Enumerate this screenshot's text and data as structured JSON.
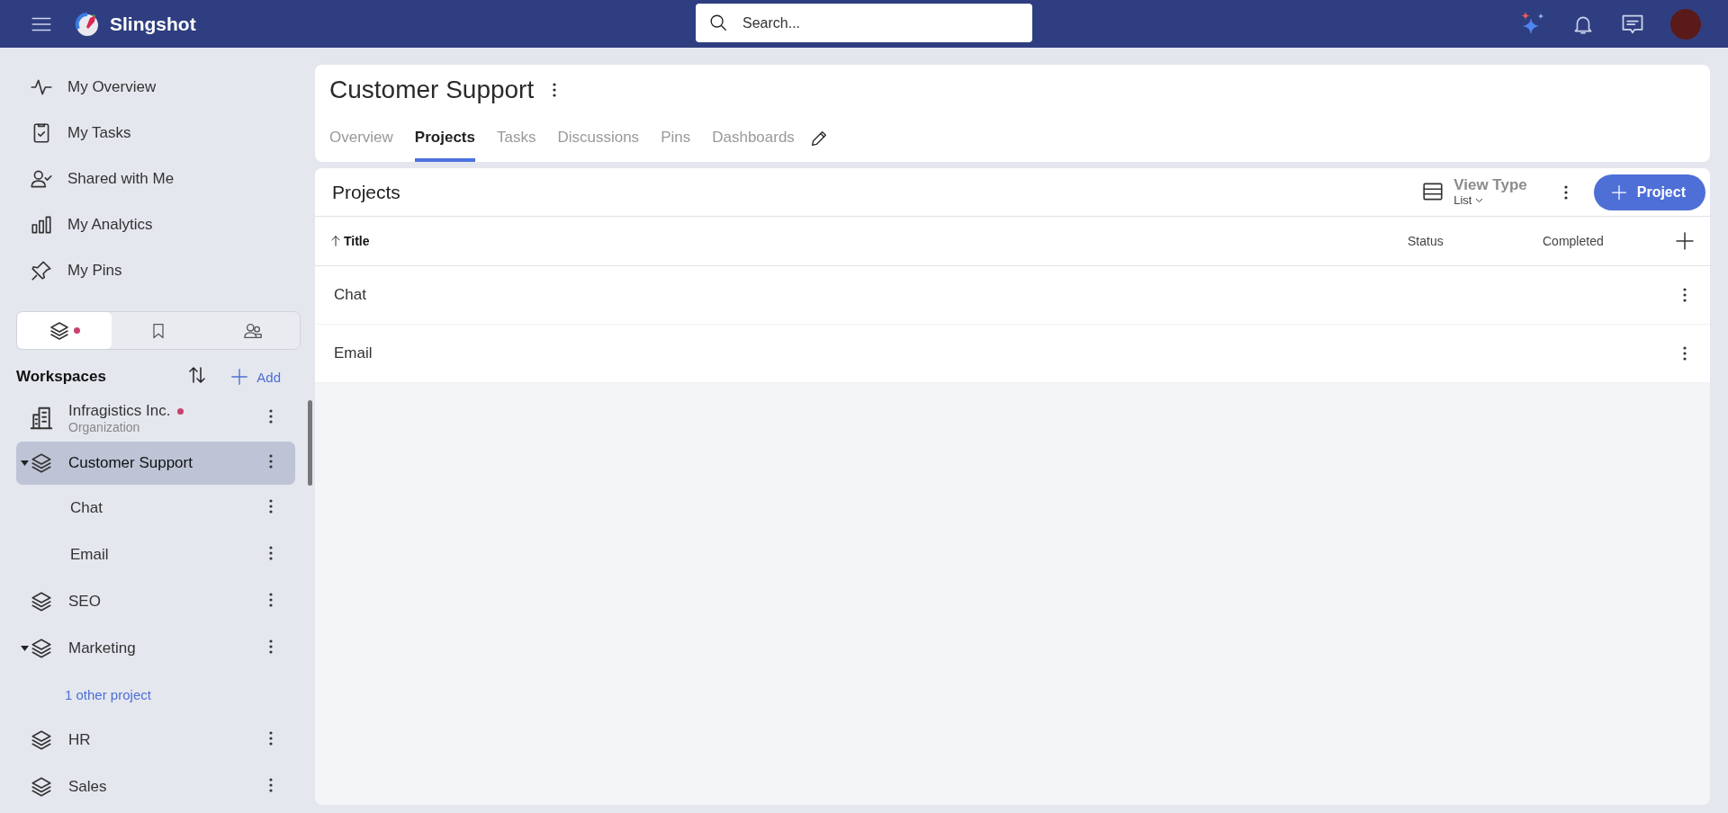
{
  "topbar": {
    "app_name": "Slingshot",
    "search": {
      "placeholder": "Search..."
    }
  },
  "sidebar": {
    "nav": [
      {
        "label": "My Overview"
      },
      {
        "label": "My Tasks"
      },
      {
        "label": "Shared with Me"
      },
      {
        "label": "My Analytics"
      },
      {
        "label": "My Pins"
      }
    ],
    "tabs": [
      {
        "selected": true,
        "unread": true
      },
      {
        "selected": false,
        "unread": false
      },
      {
        "selected": false,
        "unread": false
      }
    ],
    "workspaces": {
      "title": "Workspaces",
      "add_label": "Add",
      "items": [
        {
          "kind": "organization",
          "label": "Infragistics Inc.",
          "subtitle": "Organization",
          "unread": true,
          "selected": false
        },
        {
          "kind": "workspace",
          "label": "Customer Support",
          "selected": true,
          "expanded": true,
          "children": [
            {
              "kind": "project",
              "label": "Chat",
              "selected": false
            },
            {
              "kind": "project",
              "label": "Email",
              "selected": false
            }
          ]
        },
        {
          "kind": "workspace",
          "label": "SEO",
          "selected": false,
          "expanded": false
        },
        {
          "kind": "workspace",
          "label": "Marketing",
          "selected": false,
          "expanded": true,
          "children": [
            {
              "kind": "more",
              "label": "1 other project",
              "selected": false
            }
          ]
        },
        {
          "kind": "workspace",
          "label": "HR",
          "selected": false,
          "expanded": false
        },
        {
          "kind": "workspace",
          "label": "Sales",
          "selected": false,
          "expanded": false
        }
      ]
    }
  },
  "header": {
    "title": "Customer Support",
    "tabs": [
      {
        "label": "Overview",
        "selected": false
      },
      {
        "label": "Projects",
        "selected": true
      },
      {
        "label": "Tasks",
        "selected": false
      },
      {
        "label": "Discussions",
        "selected": false
      },
      {
        "label": "Pins",
        "selected": false
      },
      {
        "label": "Dashboards",
        "selected": false
      }
    ]
  },
  "projects": {
    "title": "Projects",
    "view_type": {
      "label": "View Type",
      "value": "List"
    },
    "add_button": "Project",
    "columns": [
      {
        "label": "Title",
        "sorted": true
      },
      {
        "label": "Status",
        "sorted": false
      },
      {
        "label": "Completed",
        "sorted": false
      }
    ],
    "rows": [
      {
        "title": "Chat"
      },
      {
        "title": "Email"
      }
    ]
  }
}
